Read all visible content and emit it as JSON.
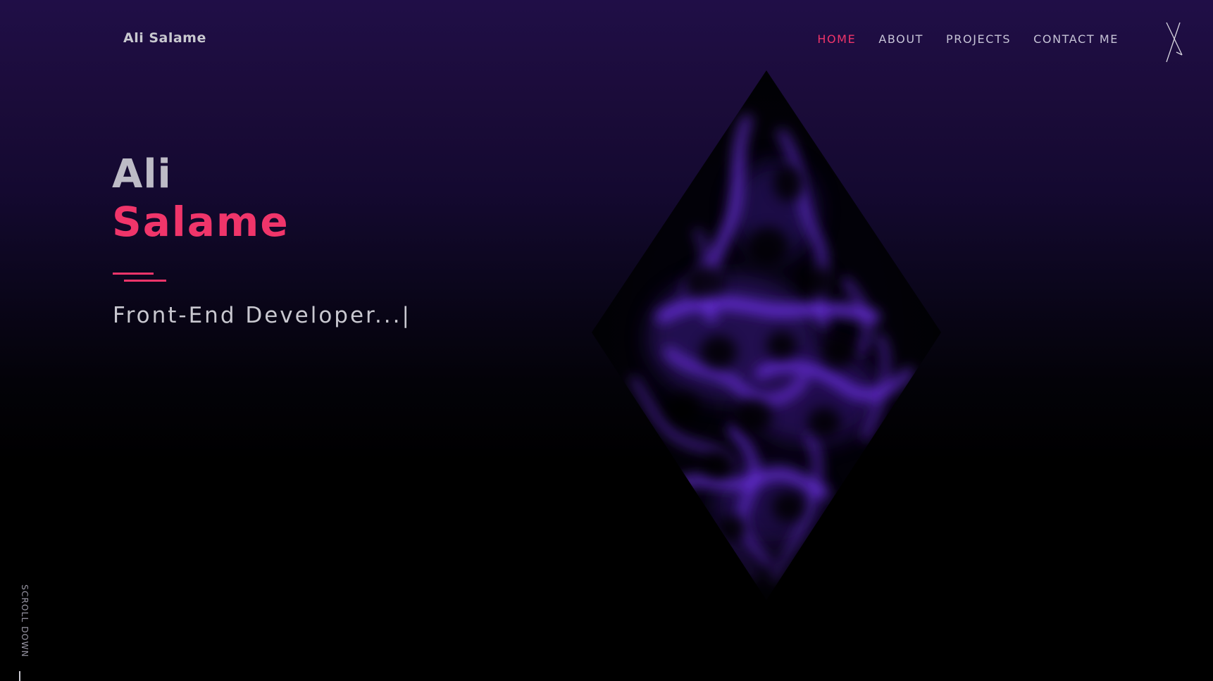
{
  "header": {
    "logo": "Ali Salame",
    "nav": [
      {
        "label": "HOME",
        "active": true
      },
      {
        "label": "ABOUT",
        "active": false
      },
      {
        "label": "PROJECTS",
        "active": false
      },
      {
        "label": "CONTACT ME",
        "active": false
      }
    ],
    "menu_icon": "close-x-icon"
  },
  "hero": {
    "first_name": "Ali",
    "last_name": "Salame",
    "role": "Front-End Developer...|"
  },
  "visual": {
    "shape_icon": "diamond-fluid-artwork",
    "glow_color": "#6a2fe0"
  },
  "scroll_indicator": {
    "label": "SCROLL DOWN"
  },
  "colors": {
    "accent": "#f0356a",
    "text": "#c8c8cf",
    "bg_top": "#200e47",
    "bg_bottom": "#000000"
  }
}
